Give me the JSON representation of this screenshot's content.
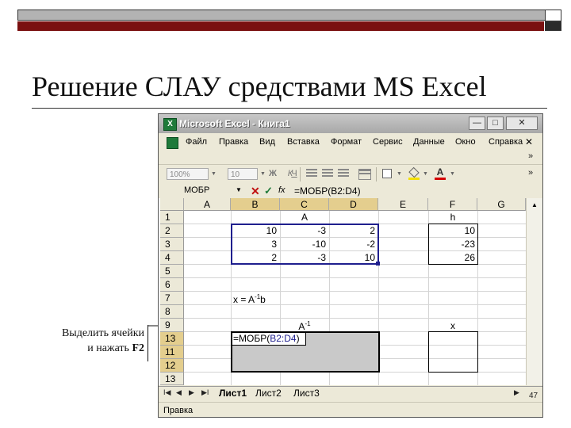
{
  "slide": {
    "title": "Решение СЛАУ средствами MS Excel",
    "note_line1": "Выделить ячейки",
    "note_line2_prefix": "и нажать ",
    "note_line2_key": "F2"
  },
  "excel": {
    "window_title": "Microsoft Excel - Книга1",
    "window_buttons": [
      "—",
      "□",
      "✕"
    ],
    "menu": [
      "Файл",
      "Правка",
      "Вид",
      "Вставка",
      "Формат",
      "Сервис",
      "Данные",
      "Окно",
      "Справка"
    ],
    "menu_close": "✕",
    "toolbar": {
      "zoom": "100%",
      "font_size": "10",
      "bold": "Ж",
      "italic": "К",
      "underline": "Ч",
      "chevron": "»"
    },
    "formula_bar": {
      "name_box": "МОБР",
      "fx": "fx",
      "content": "=МОБР(B2:D4)"
    },
    "columns": [
      "A",
      "B",
      "C",
      "D",
      "E",
      "F",
      "G"
    ],
    "rows": [
      "1",
      "2",
      "3",
      "4",
      "5",
      "6",
      "7",
      "8",
      "9",
      "13",
      "11",
      "12",
      "13"
    ],
    "cells": {
      "C1": "A",
      "F1": "h",
      "B2": "10",
      "C2": "-3",
      "D2": "2",
      "F2": "10",
      "B3": "3",
      "C3": "-10",
      "D3": "-2",
      "F3": "-23",
      "B4": "2",
      "C4": "-3",
      "D4": "10",
      "F4": "26",
      "B7_text": "x = A",
      "B7_sup": "-1",
      "B7_tail": "b",
      "C9_text": "A",
      "C9_sup": "-1",
      "F9": "x",
      "edit_prefix": "=МОБР(",
      "edit_ref": "B2:D4",
      "edit_suffix": ")"
    },
    "sheets": [
      "Лист1",
      "Лист2",
      "Лист3"
    ],
    "active_sheet": "Лист1",
    "status": "Правка",
    "page_number": "47",
    "colors": {
      "selection_border": "#1f1f8e",
      "selected_header": "#e4ce8e",
      "range_fill": "#c9c9c9"
    }
  }
}
